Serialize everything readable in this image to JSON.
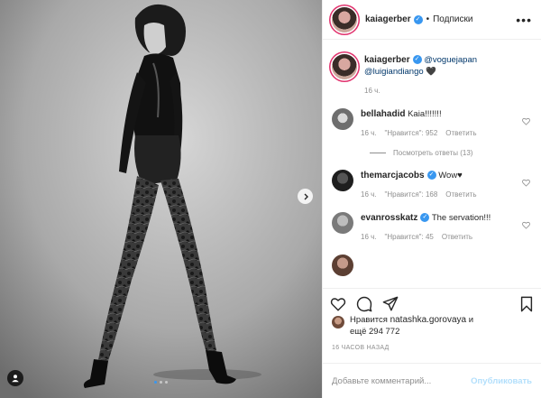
{
  "header": {
    "username": "kaiagerber",
    "separator": "•",
    "follow_label": "Подписки",
    "more_icon": "more-horizontal-icon"
  },
  "caption": {
    "username": "kaiagerber",
    "mention1": "@voguejapan",
    "mention2": "@luigiandiango",
    "heart": "🖤",
    "time": "16 ч."
  },
  "comments": [
    {
      "username": "bellahadid",
      "verified": false,
      "text": "Kaia!!!!!!!",
      "time": "16 ч.",
      "likes": "\"Нравится\": 952",
      "reply": "Ответить"
    },
    {
      "username": "themarcjacobs",
      "verified": true,
      "text": "Wow♥",
      "time": "16 ч.",
      "likes": "\"Нравится\": 168",
      "reply": "Ответить"
    },
    {
      "username": "evanrosskatz",
      "verified": true,
      "text": "The servation!!!",
      "time": "16 ч.",
      "likes": "\"Нравится\": 45",
      "reply": "Ответить"
    }
  ],
  "view_replies": "Посмотреть ответы (13)",
  "likes": {
    "prefix": "Нравится",
    "user": "natashka.gorovaya",
    "suffix": "и",
    "line2": "ещё 294 772"
  },
  "posted": "16 ЧАСОВ НАЗАД",
  "add_comment": {
    "placeholder": "Добавьте комментарий...",
    "post_label": "Опубликовать"
  },
  "carousel": {
    "count": 3,
    "active": 0
  },
  "colors": {
    "accent": "#3897f0",
    "muted": "#8e8e8e",
    "post_disabled": "#b2dffc"
  }
}
